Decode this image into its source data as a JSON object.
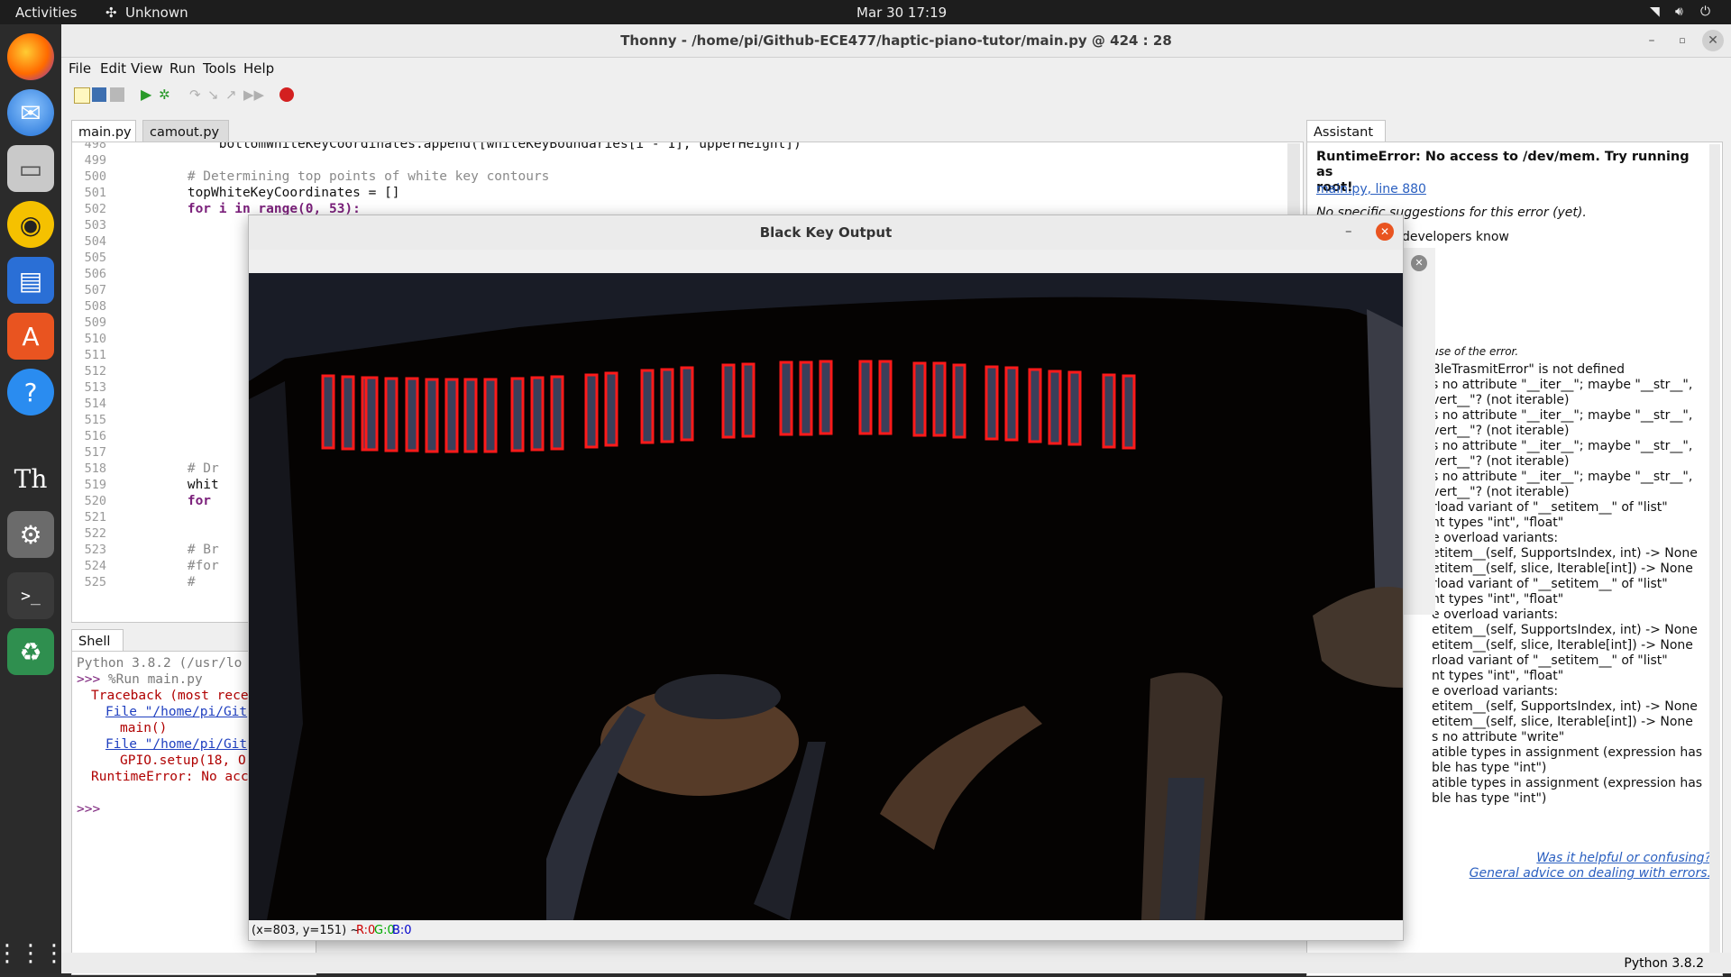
{
  "topbar": {
    "activities": "Activities",
    "app": "Unknown",
    "clock": "Mar 30  17:19"
  },
  "dock": {
    "items": [
      "firefox-icon",
      "thunderbird-icon",
      "files-icon",
      "rhythmbox-icon",
      "writer-icon",
      "software-icon",
      "help-icon",
      "thonny-icon",
      "settings-icon",
      "terminal-icon",
      "trash-icon",
      "app-grid-icon"
    ]
  },
  "window": {
    "title": "Thonny  -  /home/pi/Github-ECE477/haptic-piano-tutor/main.py  @  424 : 28"
  },
  "menu": [
    "File",
    "Edit",
    "View",
    "Run",
    "Tools",
    "Help"
  ],
  "editor": {
    "tabs": [
      "main.py",
      "camout.py"
    ],
    "lines": [
      {
        "n": "498",
        "t": "            bottomWhiteKeyCoordinates.append([whiteKeyBoundaries[i - 1], upperHeight])",
        "c": ""
      },
      {
        "n": "499",
        "t": "",
        "c": ""
      },
      {
        "n": "500",
        "t": "        # Determining top points of white key contours",
        "c": "cm"
      },
      {
        "n": "501",
        "t": "        topWhiteKeyCoordinates = []",
        "c": ""
      },
      {
        "n": "502",
        "t": "        for i in range(0, 53):",
        "c": "kw"
      },
      {
        "n": "503",
        "t": "",
        "c": ""
      },
      {
        "n": "504",
        "t": "",
        "c": ""
      },
      {
        "n": "505",
        "t": "",
        "c": ""
      },
      {
        "n": "506",
        "t": "",
        "c": ""
      },
      {
        "n": "507",
        "t": "",
        "c": ""
      },
      {
        "n": "508",
        "t": "",
        "c": ""
      },
      {
        "n": "509",
        "t": "",
        "c": ""
      },
      {
        "n": "510",
        "t": "",
        "c": ""
      },
      {
        "n": "511",
        "t": "",
        "c": ""
      },
      {
        "n": "512",
        "t": "",
        "c": ""
      },
      {
        "n": "513",
        "t": "",
        "c": ""
      },
      {
        "n": "514",
        "t": "",
        "c": ""
      },
      {
        "n": "515",
        "t": "",
        "c": ""
      },
      {
        "n": "516",
        "t": "",
        "c": ""
      },
      {
        "n": "517",
        "t": "",
        "c": ""
      },
      {
        "n": "518",
        "t": "        # Dr",
        "c": "cm"
      },
      {
        "n": "519",
        "t": "        whit",
        "c": ""
      },
      {
        "n": "520",
        "t": "        for",
        "c": "kw"
      },
      {
        "n": "521",
        "t": "",
        "c": ""
      },
      {
        "n": "522",
        "t": "",
        "c": ""
      },
      {
        "n": "523",
        "t": "        # Br",
        "c": "cm"
      },
      {
        "n": "524",
        "t": "        #for",
        "c": "cm"
      },
      {
        "n": "525",
        "t": "        #",
        "c": "cm"
      }
    ]
  },
  "shell": {
    "tab": "Shell",
    "lines": [
      {
        "t": "Python 3.8.2 (/usr/lo",
        "c": "#7a7a7a",
        "i": 0
      },
      {
        "t": ">>> ",
        "t2": "%Run main.py",
        "c": "#7a1f7a",
        "c2": "#7a7a7a",
        "i": 0
      },
      {
        "t": "Traceback (most rece",
        "c": "#b00000",
        "i": 1
      },
      {
        "t": "File \"/home/pi/Git",
        "c": "#2040c0",
        "i": 2,
        "u": true
      },
      {
        "t": "main()",
        "c": "#b00000",
        "i": 3
      },
      {
        "t": "File \"/home/pi/Git",
        "c": "#2040c0",
        "i": 2,
        "u": true
      },
      {
        "t": "GPIO.setup(18, O",
        "c": "#b00000",
        "i": 3
      },
      {
        "t": "RuntimeError: No acc",
        "c": "#b00000",
        "i": 1
      },
      {
        "t": "",
        "c": "#111",
        "i": 0
      },
      {
        "t": ">>>",
        "c": "#7a1f7a",
        "i": 0
      }
    ]
  },
  "assistant": {
    "tab": "Assistant",
    "heading": "RuntimeError: No access to /dev/mem.  Try running as\nroot!",
    "link": "main.py, line 880",
    "note": "No specific suggestions for this error (yet).",
    "let_know": "developers know",
    "cause": "use of the error.",
    "lines": [
      "BleTrasmitError\" is not defined",
      "s no attribute \"__iter__\"; maybe \"__str__\",",
      "vert__\"? (not iterable)",
      "s no attribute \"__iter__\"; maybe \"__str__\",",
      "vert__\"? (not iterable)",
      "s no attribute \"__iter__\"; maybe \"__str__\",",
      "vert__\"? (not iterable)",
      "s no attribute \"__iter__\"; maybe \"__str__\",",
      "vert__\"? (not iterable)",
      "rload variant of \"__setitem__\" of \"list\"",
      "nt types \"int\", \"float\"",
      "e overload variants:",
      "etitem__(self, SupportsIndex, int) -> None",
      "etitem__(self, slice, Iterable[int]) -> None",
      "rload variant of \"__setitem__\" of \"list\"",
      "nt types \"int\", \"float\"",
      "e overload variants:",
      "etitem__(self, SupportsIndex, int) -> None",
      "etitem__(self, slice, Iterable[int]) -> None",
      "rload variant of \"__setitem__\" of \"list\"",
      "nt types \"int\", \"float\"",
      "e overload variants:",
      "etitem__(self, SupportsIndex, int) -> None",
      "etitem__(self, slice, Iterable[int]) -> None",
      "s no attribute \"write\"",
      "atible types in assignment (expression has",
      "ble has type \"int\")",
      "atible types in assignment (expression has",
      "ble has type \"int\")"
    ],
    "helpful": "Was it helpful or confusing?",
    "advice": "General advice on dealing with errors."
  },
  "status": {
    "python": "Python 3.8.2"
  },
  "cv_window": {
    "title": "Black Key Output",
    "status_coords": "(x=803, y=151) ~ ",
    "r": "R:0",
    "g": "G:0",
    "b": "B:0"
  },
  "colors": {
    "accent_close": "#e95420",
    "contour": "#ff1a1a",
    "link": "#2a5fc0"
  }
}
